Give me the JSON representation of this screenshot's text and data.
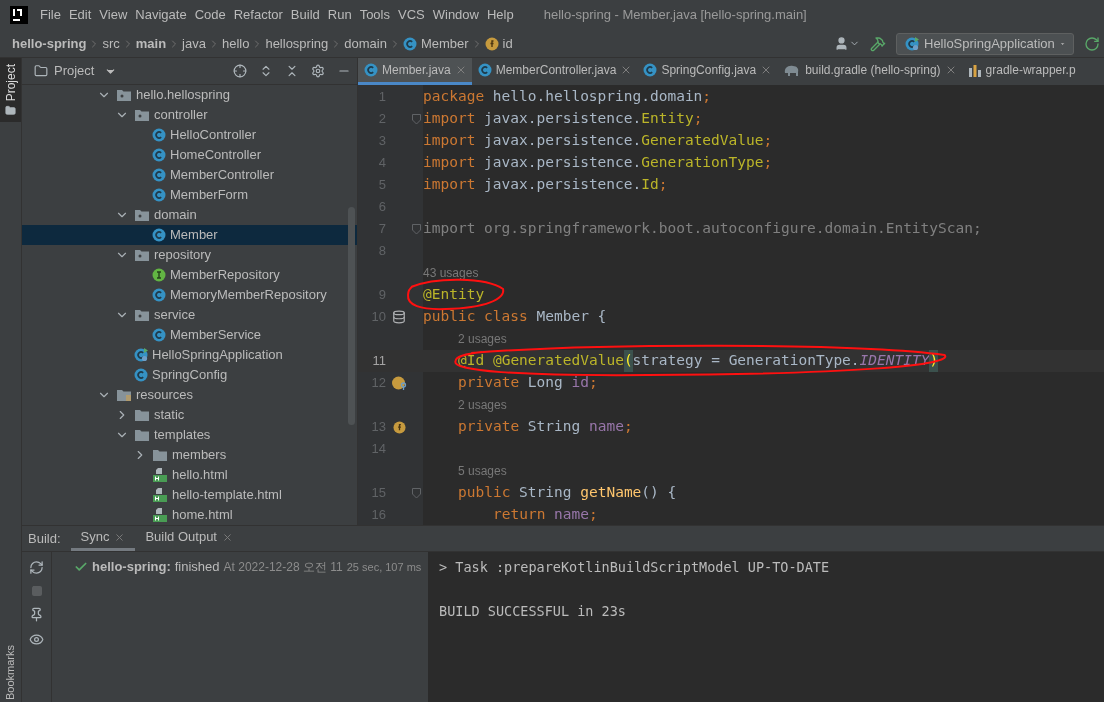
{
  "menu": [
    "File",
    "Edit",
    "View",
    "Navigate",
    "Code",
    "Refactor",
    "Build",
    "Run",
    "Tools",
    "VCS",
    "Window",
    "Help"
  ],
  "window": {
    "title": "hello-spring - Member.java [hello-spring.main]"
  },
  "breadcrumb": [
    {
      "label": "hello-spring",
      "kind": "project"
    },
    {
      "label": "src",
      "kind": "dir"
    },
    {
      "label": "main",
      "kind": "project"
    },
    {
      "label": "java",
      "kind": "dir"
    },
    {
      "label": "hello",
      "kind": "dir"
    },
    {
      "label": "hellospring",
      "kind": "dir"
    },
    {
      "label": "domain",
      "kind": "dir"
    },
    {
      "label": "Member",
      "kind": "class"
    },
    {
      "label": "id",
      "kind": "field"
    }
  ],
  "run_config": {
    "label": "HelloSpringApplication"
  },
  "tool_strip": {
    "top": {
      "label": "Project",
      "selected": true
    },
    "bottom": {
      "label": "Bookmarks",
      "selected": false
    }
  },
  "project_panel": {
    "title": "Project",
    "tree": [
      {
        "label": "hello.hellospring",
        "kind": "package",
        "expanded": true,
        "selected": false,
        "children": [
          {
            "label": "controller",
            "kind": "package",
            "expanded": true,
            "selected": false,
            "children": [
              {
                "label": "HelloController",
                "kind": "class",
                "selected": false
              },
              {
                "label": "HomeController",
                "kind": "class",
                "selected": false
              },
              {
                "label": "MemberController",
                "kind": "class",
                "selected": false
              },
              {
                "label": "MemberForm",
                "kind": "class",
                "selected": false
              }
            ]
          },
          {
            "label": "domain",
            "kind": "package",
            "expanded": true,
            "selected": false,
            "children": [
              {
                "label": "Member",
                "kind": "class",
                "selected": true
              }
            ]
          },
          {
            "label": "repository",
            "kind": "package",
            "expanded": true,
            "selected": false,
            "children": [
              {
                "label": "MemberRepository",
                "kind": "interface",
                "selected": false
              },
              {
                "label": "MemoryMemberRepository",
                "kind": "class",
                "selected": false
              }
            ]
          },
          {
            "label": "service",
            "kind": "package",
            "expanded": true,
            "selected": false,
            "children": [
              {
                "label": "MemberService",
                "kind": "class",
                "selected": false
              }
            ]
          },
          {
            "label": "HelloSpringApplication",
            "kind": "app",
            "selected": false
          },
          {
            "label": "SpringConfig",
            "kind": "class",
            "selected": false
          }
        ]
      },
      {
        "label": "resources",
        "kind": "resources",
        "expanded": true,
        "selected": false,
        "children": [
          {
            "label": "static",
            "kind": "folder",
            "expanded": false,
            "selected": false
          },
          {
            "label": "templates",
            "kind": "folder",
            "expanded": true,
            "selected": false,
            "children": [
              {
                "label": "members",
                "kind": "folder",
                "expanded": false,
                "selected": false
              },
              {
                "label": "hello.html",
                "kind": "html",
                "selected": false
              },
              {
                "label": "hello-template.html",
                "kind": "html",
                "selected": false
              },
              {
                "label": "home.html",
                "kind": "html",
                "selected": false
              }
            ]
          }
        ]
      }
    ]
  },
  "editor_tabs": [
    {
      "label": "Member.java",
      "kind": "class",
      "selected": true,
      "closable": true
    },
    {
      "label": "MemberController.java",
      "kind": "class",
      "selected": false,
      "closable": true
    },
    {
      "label": "SpringConfig.java",
      "kind": "class",
      "selected": false,
      "closable": true
    },
    {
      "label": "build.gradle (hello-spring)",
      "kind": "gradle",
      "selected": false,
      "closable": true
    },
    {
      "label": "gradle-wrapper.p",
      "kind": "properties",
      "selected": false,
      "closable": false
    }
  ],
  "editor": {
    "lines": [
      {
        "kind": "code",
        "number": "1",
        "current": false,
        "fold": false,
        "circled": false,
        "tokens": [
          {
            "text": "package",
            "kind": "keyword"
          },
          {
            "text": " hello.hellospring.domain",
            "kind": "plain"
          },
          {
            "text": ";",
            "kind": "keyword"
          }
        ]
      },
      {
        "kind": "code",
        "number": "2",
        "current": false,
        "fold": true,
        "circled": false,
        "tokens": [
          {
            "text": "import",
            "kind": "keyword"
          },
          {
            "text": " javax.persistence.",
            "kind": "plain"
          },
          {
            "text": "Entity",
            "kind": "annotation"
          },
          {
            "text": ";",
            "kind": "keyword"
          }
        ]
      },
      {
        "kind": "code",
        "number": "3",
        "current": false,
        "fold": false,
        "circled": false,
        "tokens": [
          {
            "text": "import",
            "kind": "keyword"
          },
          {
            "text": " javax.persistence.",
            "kind": "plain"
          },
          {
            "text": "GeneratedValue",
            "kind": "annotation"
          },
          {
            "text": ";",
            "kind": "keyword"
          }
        ]
      },
      {
        "kind": "code",
        "number": "4",
        "current": false,
        "fold": false,
        "circled": false,
        "tokens": [
          {
            "text": "import",
            "kind": "keyword"
          },
          {
            "text": " javax.persistence.",
            "kind": "plain"
          },
          {
            "text": "GenerationType",
            "kind": "annotation"
          },
          {
            "text": ";",
            "kind": "keyword"
          }
        ]
      },
      {
        "kind": "code",
        "number": "5",
        "current": false,
        "fold": false,
        "circled": false,
        "tokens": [
          {
            "text": "import",
            "kind": "keyword"
          },
          {
            "text": " javax.persistence.",
            "kind": "plain"
          },
          {
            "text": "Id",
            "kind": "annotation"
          },
          {
            "text": ";",
            "kind": "keyword"
          }
        ]
      },
      {
        "kind": "code",
        "number": "6",
        "current": false,
        "fold": false,
        "circled": false
      },
      {
        "kind": "code",
        "number": "7",
        "current": false,
        "fold": true,
        "circled": false,
        "tokens": [
          {
            "text": "import org.springframework.boot.autoconfigure.domain.EntityScan;",
            "kind": "unused"
          }
        ]
      },
      {
        "kind": "code",
        "number": "8",
        "current": false,
        "fold": false,
        "circled": false
      },
      {
        "kind": "hint",
        "text": "43 usages"
      },
      {
        "kind": "code",
        "number": "9",
        "current": false,
        "fold": false,
        "circled": true,
        "tokens": [
          {
            "text": "@Entity",
            "kind": "annotation"
          }
        ]
      },
      {
        "kind": "code",
        "number": "10",
        "current": false,
        "fold": false,
        "circled": false,
        "gutter": {
          "kind": "entity"
        },
        "tokens": [
          {
            "text": "public class",
            "kind": "keyword"
          },
          {
            "text": " Member {",
            "kind": "plain"
          }
        ],
        "children": [
          {
            "kind": "hint",
            "text": "2 usages"
          },
          {
            "kind": "code",
            "number": "11",
            "current": true,
            "fold": false,
            "circled": true,
            "tokens": [
              {
                "text": "@Id @GeneratedValue",
                "kind": "annotation"
              },
              {
                "text": "(",
                "kind": "paren"
              },
              {
                "text": "strategy = GenerationType.",
                "kind": "plain"
              },
              {
                "text": "IDENTITY",
                "kind": "constant"
              },
              {
                "text": ")",
                "kind": "paren"
              }
            ]
          },
          {
            "kind": "code",
            "number": "12",
            "current": false,
            "fold": false,
            "circled": false,
            "gutter": {
              "kind": "id-field"
            },
            "tokens": [
              {
                "text": "private",
                "kind": "keyword"
              },
              {
                "text": " Long ",
                "kind": "plain"
              },
              {
                "text": "id",
                "kind": "field"
              },
              {
                "text": ";",
                "kind": "keyword"
              }
            ]
          },
          {
            "kind": "hint",
            "text": "2 usages"
          },
          {
            "kind": "code",
            "number": "13",
            "current": false,
            "fold": false,
            "circled": false,
            "gutter": {
              "kind": "field"
            },
            "tokens": [
              {
                "text": "private",
                "kind": "keyword"
              },
              {
                "text": " String ",
                "kind": "plain"
              },
              {
                "text": "name",
                "kind": "field"
              },
              {
                "text": ";",
                "kind": "keyword"
              }
            ]
          },
          {
            "kind": "code",
            "number": "14",
            "current": false,
            "fold": false,
            "circled": false
          },
          {
            "kind": "hint",
            "text": "5 usages"
          },
          {
            "kind": "code",
            "number": "15",
            "current": false,
            "fold": true,
            "circled": false,
            "tokens": [
              {
                "text": "public",
                "kind": "keyword"
              },
              {
                "text": " String ",
                "kind": "plain"
              },
              {
                "text": "getName",
                "kind": "method"
              },
              {
                "text": "() {",
                "kind": "plain"
              }
            ],
            "children": [
              {
                "kind": "code",
                "number": "16",
                "current": false,
                "fold": false,
                "circled": false,
                "tokens": [
                  {
                    "text": "return",
                    "kind": "keyword"
                  },
                  {
                    "text": " name",
                    "kind": "field"
                  },
                  {
                    "text": ";",
                    "kind": "keyword"
                  }
                ]
              }
            ]
          }
        ]
      }
    ]
  },
  "build_panel": {
    "label": "Build:",
    "tabs": [
      {
        "label": "Sync",
        "selected": true
      },
      {
        "label": "Build Output",
        "selected": false
      }
    ],
    "result": {
      "project": "hello-spring:",
      "status": "finished",
      "time": "At 2022-12-28 오전 11",
      "duration": "25 sec, 107 ms"
    },
    "console": [
      {
        "kind": "task",
        "text": "> Task :prepareKotlinBuildScriptModel UP-TO-DATE"
      },
      {
        "kind": "summary",
        "text": "BUILD SUCCESSFUL in 23s"
      }
    ]
  }
}
